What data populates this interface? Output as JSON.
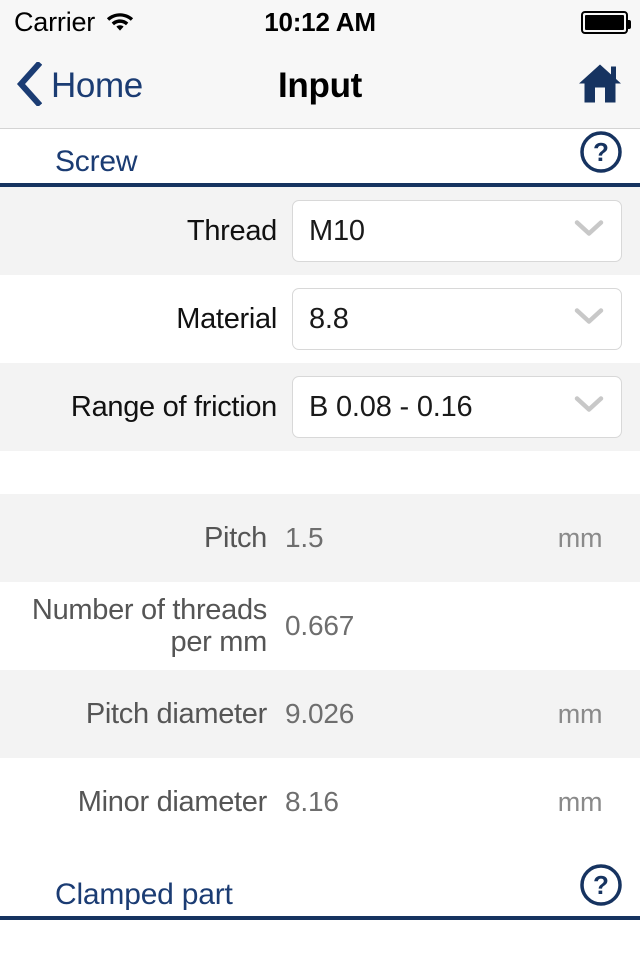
{
  "status_bar": {
    "carrier": "Carrier",
    "wifi_icon": "wifi-icon",
    "time": "10:12 AM",
    "battery_icon": "battery-full-icon"
  },
  "nav_bar": {
    "back_icon": "chevron-left-icon",
    "back_label": "Home",
    "title": "Input",
    "home_icon": "home-icon"
  },
  "colors": {
    "navy": "#163360",
    "link_blue": "#1b3c73",
    "row_alt_bg": "#f3f3f3",
    "value_gray": "#6e6e6e",
    "unit_gray": "#8a8a8a"
  },
  "sections": [
    {
      "title": "Screw",
      "help_icon": "help-circle-icon",
      "rows": [
        {
          "type": "select",
          "label": "Thread",
          "value": "M10",
          "chevron_icon": "chevron-down-icon",
          "unit": ""
        },
        {
          "type": "select",
          "label": "Material",
          "value": "8.8",
          "chevron_icon": "chevron-down-icon",
          "unit": ""
        },
        {
          "type": "select",
          "label": "Range of friction",
          "value": "B 0.08 - 0.16",
          "chevron_icon": "chevron-down-icon",
          "unit": ""
        },
        {
          "type": "readonly",
          "label": "Pitch",
          "value": "1.5",
          "unit": "mm"
        },
        {
          "type": "readonly",
          "label": "Number of threads\nper mm",
          "value": "0.667",
          "unit": ""
        },
        {
          "type": "readonly",
          "label": "Pitch diameter",
          "value": "9.026",
          "unit": "mm"
        },
        {
          "type": "readonly",
          "label": "Minor diameter",
          "value": "8.16",
          "unit": "mm"
        }
      ]
    },
    {
      "title": "Clamped part",
      "help_icon": "help-circle-icon",
      "rows": []
    }
  ]
}
